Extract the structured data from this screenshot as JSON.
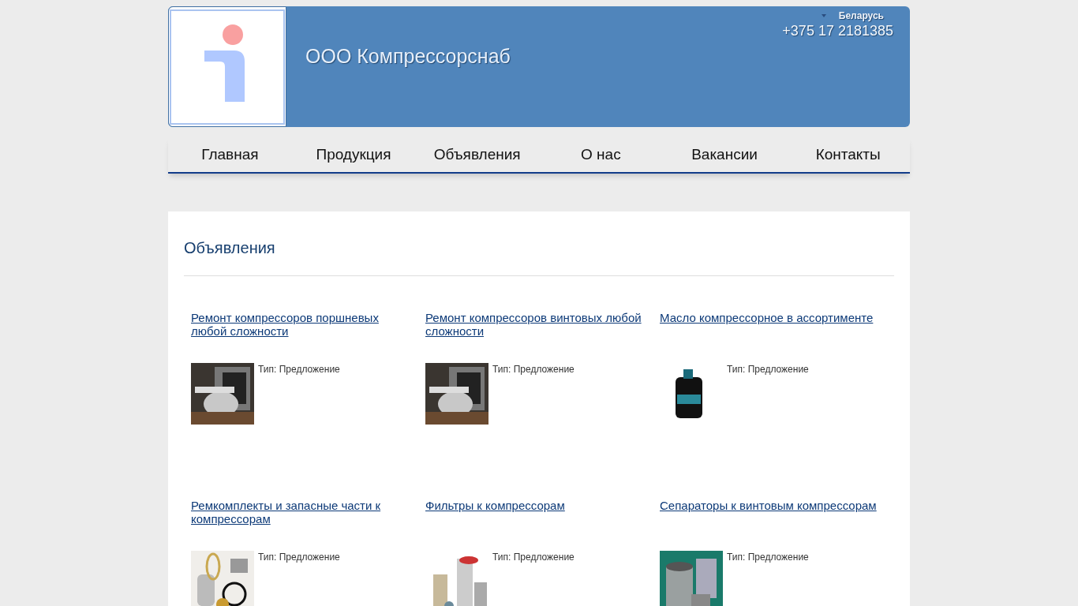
{
  "header": {
    "company": "ООО Компрессорснаб",
    "region": "Беларусь",
    "phone": "+375 17 2181385"
  },
  "nav": [
    {
      "label": "Главная"
    },
    {
      "label": "Продукция"
    },
    {
      "label": "Объявления"
    },
    {
      "label": "О нас"
    },
    {
      "label": "Вакансии"
    },
    {
      "label": "Контакты"
    }
  ],
  "page_title": "Объявления",
  "ads": [
    {
      "title": "Ремонт компрессоров поршневых любой сложности",
      "type": "Тип: Предложение"
    },
    {
      "title": "Ремонт компрессоров винтовых любой сложности",
      "type": "Тип: Предложение"
    },
    {
      "title": "Масло компрессорное в ассортименте",
      "type": "Тип: Предложение"
    },
    {
      "title": "Ремкомплекты и запасные части к компрессорам",
      "type": "Тип: Предложение"
    },
    {
      "title": "Фильтры к компрессорам",
      "type": "Тип: Предложение"
    },
    {
      "title": "Сепараторы к винтовым компрессорам",
      "type": "Тип: Предложение"
    }
  ]
}
